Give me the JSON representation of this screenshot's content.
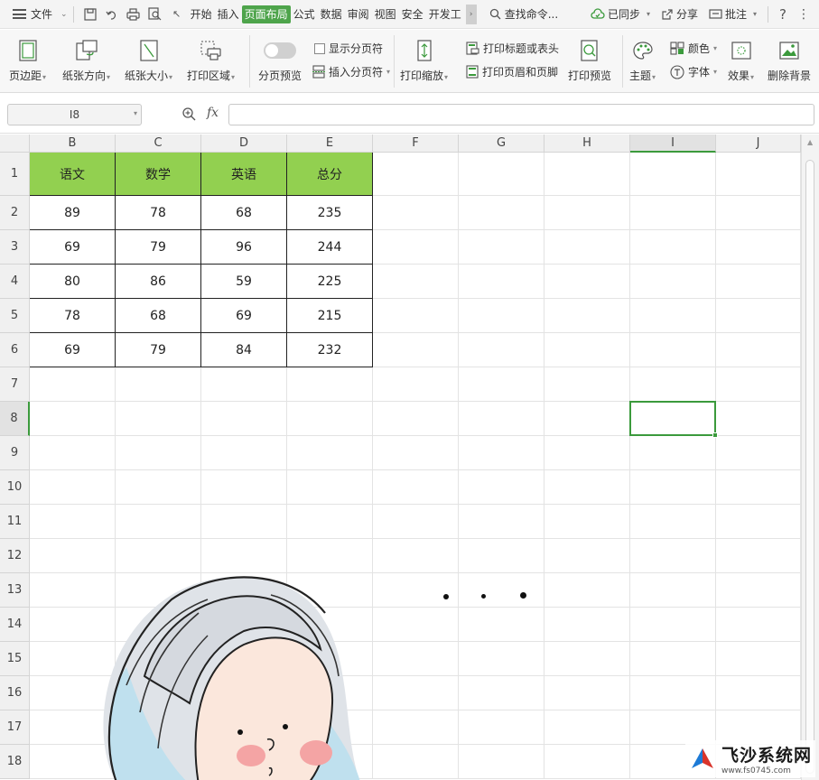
{
  "menubar": {
    "file_label": "文件",
    "tabs": [
      {
        "label": "开始",
        "active": false
      },
      {
        "label": "插入",
        "active": false
      },
      {
        "label": "页面布局",
        "active": true
      },
      {
        "label": "公式",
        "active": false
      },
      {
        "label": "数据",
        "active": false
      },
      {
        "label": "审阅",
        "active": false
      },
      {
        "label": "视图",
        "active": false
      },
      {
        "label": "安全",
        "active": false
      },
      {
        "label": "开发工",
        "active": false
      }
    ],
    "search_label": "查找命令...",
    "sync_label": "已同步",
    "share_label": "分享",
    "comment_label": "批注",
    "help_label": "?"
  },
  "ribbon": {
    "margins": "页边距",
    "orientation": "纸张方向",
    "size": "纸张大小",
    "print_area": "打印区域",
    "page_break_preview": "分页预览",
    "show_page_breaks": "显示分页符",
    "insert_page_break": "插入分页符",
    "print_scale": "打印缩放",
    "print_titles": "打印标题或表头",
    "print_header_footer": "打印页眉和页脚",
    "print_preview": "打印预览",
    "theme": "主题",
    "colors": "颜色",
    "fonts": "字体",
    "effects": "效果",
    "delete_background": "删除背景"
  },
  "formula_bar": {
    "name_box": "I8",
    "fx_label": "fx",
    "formula_value": ""
  },
  "sheet": {
    "columns": [
      "B",
      "C",
      "D",
      "E",
      "F",
      "G",
      "H",
      "I",
      "J"
    ],
    "selected_column": "I",
    "rows": [
      "1",
      "2",
      "3",
      "4",
      "5",
      "6",
      "7",
      "8",
      "9",
      "10",
      "11",
      "12",
      "13",
      "14",
      "15",
      "16",
      "17",
      "18"
    ],
    "selected_row": "8",
    "table_headers": [
      "语文",
      "数学",
      "英语",
      "总分"
    ],
    "table_rows": [
      [
        "89",
        "78",
        "68",
        "235"
      ],
      [
        "69",
        "79",
        "96",
        "244"
      ],
      [
        "80",
        "86",
        "59",
        "225"
      ],
      [
        "78",
        "68",
        "69",
        "215"
      ],
      [
        "69",
        "79",
        "84",
        "232"
      ]
    ],
    "header_fill_color": "#92d050",
    "selection_color": "#3b9a3c"
  },
  "watermark": {
    "title": "飞沙系统网",
    "url": "www.fs0745.com"
  }
}
